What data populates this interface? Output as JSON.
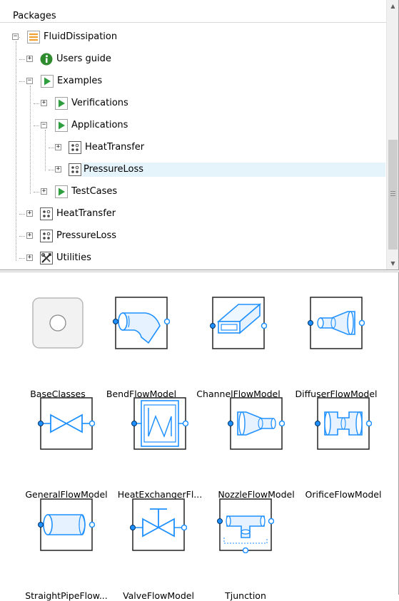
{
  "tree": {
    "header": "Packages",
    "items": [
      {
        "label": "FluidDissipation",
        "icon": "package-stack-icon",
        "toggle": "−"
      },
      {
        "label": "Users guide",
        "icon": "info-icon",
        "toggle": "+"
      },
      {
        "label": "Examples",
        "icon": "play-icon",
        "toggle": "−"
      },
      {
        "label": "Verifications",
        "icon": "play-icon",
        "toggle": "+"
      },
      {
        "label": "Applications",
        "icon": "play-icon",
        "toggle": "−"
      },
      {
        "label": "HeatTransfer",
        "icon": "package-dots-icon",
        "toggle": "+"
      },
      {
        "label": "PressureLoss",
        "icon": "package-dots-icon",
        "toggle": "+"
      },
      {
        "label": "TestCases",
        "icon": "play-icon",
        "toggle": "+"
      },
      {
        "label": "HeatTransfer",
        "icon": "package-dots-icon",
        "toggle": "+"
      },
      {
        "label": "PressureLoss",
        "icon": "package-dots-icon",
        "toggle": "+"
      },
      {
        "label": "Utilities",
        "icon": "utilities-icon",
        "toggle": "+"
      }
    ]
  },
  "grid": {
    "items": [
      {
        "label": "BaseClasses",
        "icon": "base-classes-icon"
      },
      {
        "label": "BendFlowModel",
        "icon": "bend-flow-icon"
      },
      {
        "label": "ChannelFlowModel",
        "icon": "channel-flow-icon"
      },
      {
        "label": "DiffuserFlowModel",
        "icon": "diffuser-flow-icon"
      },
      {
        "label": "GeneralFlowModel",
        "icon": "general-flow-icon"
      },
      {
        "label": "HeatExchangerFl...",
        "icon": "heat-exchanger-icon"
      },
      {
        "label": "NozzleFlowModel",
        "icon": "nozzle-flow-icon"
      },
      {
        "label": "OrificeFlowModel",
        "icon": "orifice-flow-icon"
      },
      {
        "label": "StraightPipeFlow...",
        "icon": "straight-pipe-icon"
      },
      {
        "label": "ValveFlowModel",
        "icon": "valve-flow-icon"
      },
      {
        "label": "Tjunction",
        "icon": "tjunction-icon"
      }
    ]
  },
  "colors": {
    "modelica_blue": "#1e90ff",
    "play_green": "#2e9e3e",
    "info_green": "#2e8b2e",
    "package_orange": "#f0a030",
    "selection": "#e5f3fb"
  }
}
